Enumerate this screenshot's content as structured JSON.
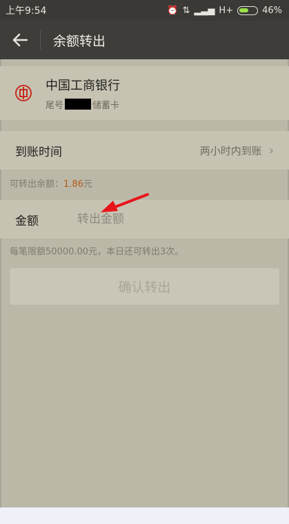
{
  "status_bar": {
    "time": "上午9:54",
    "network": "H+",
    "battery": "46%"
  },
  "app_bar": {
    "title": "余额转出"
  },
  "bank": {
    "name": "中国工商银行",
    "tail_label": "尾号",
    "card_type": "储蓄卡"
  },
  "arrival": {
    "label": "到账时间",
    "value": "两小时内到账"
  },
  "balance": {
    "label": "可转出余额：",
    "amount": "1.86",
    "unit": "元"
  },
  "amount": {
    "label": "金额",
    "placeholder": "转出金额"
  },
  "limit_text": "每笔限额50000.00元，本日还可转出3次。",
  "confirm_label": "确认转出",
  "colors": {
    "app_bar": "#3e3d39",
    "card": "#c7c3b3",
    "bank_red": "#c62d1f",
    "balance_amount": "#b05c1c",
    "annotation_arrow": "#e8141b"
  }
}
